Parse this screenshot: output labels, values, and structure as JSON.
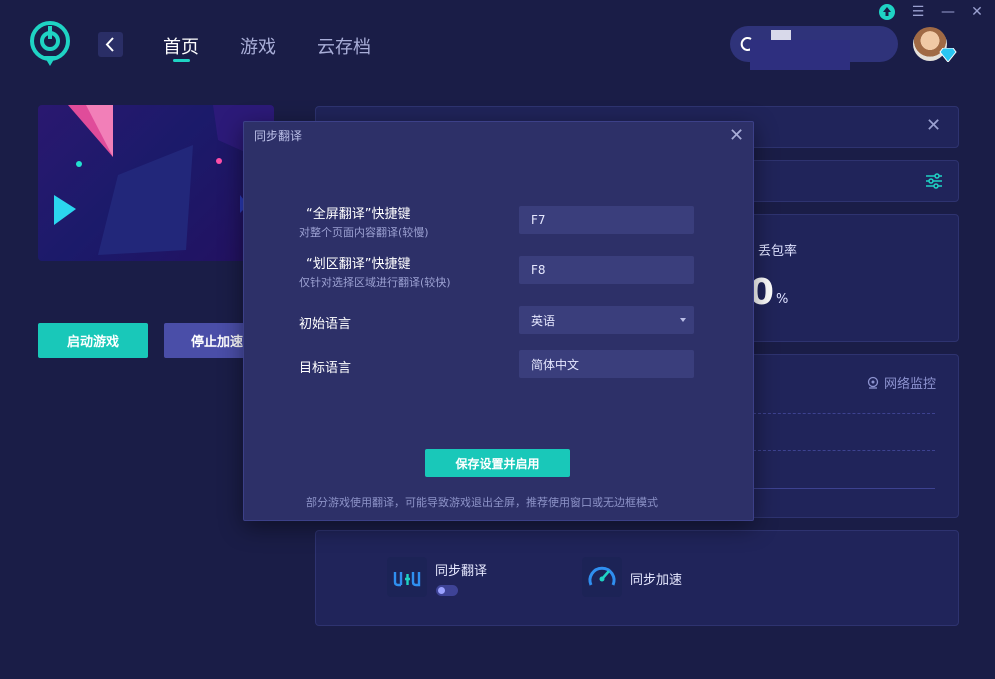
{
  "colors": {
    "accent": "#19c8b9",
    "background": "#1a1d47",
    "panel": "#20245a",
    "modal": "#2d3068"
  },
  "window_controls": {
    "update_icon": "upload-arrow-icon",
    "menu_glyph": "☰",
    "minimize_glyph": "—",
    "close_glyph": "✕"
  },
  "header": {
    "nav": [
      {
        "label": "首页",
        "active": true
      },
      {
        "label": "游戏",
        "active": false
      },
      {
        "label": "云存档",
        "active": false
      }
    ],
    "back_glyph": "‹"
  },
  "left": {
    "start_button": "启动游戏",
    "stop_button": "停止加速"
  },
  "stats": {
    "packet_loss_label": "丢包率",
    "packet_loss_value": "0",
    "packet_loss_unit": "%"
  },
  "monitor": {
    "label": "网络监控"
  },
  "features": [
    {
      "label": "同步翻译",
      "icon": "translate-icon",
      "toggle_on": false
    },
    {
      "label": "同步加速",
      "icon": "speedometer-icon"
    }
  ],
  "modal": {
    "title": "同步翻译",
    "close_glyph": "✕",
    "fields": [
      {
        "label": "“全屏翻译”快捷键",
        "sub": "对整个页面内容翻译(较慢)",
        "value": "F7"
      },
      {
        "label": "“划区翻译”快捷键",
        "sub": "仅针对选择区域进行翻译(较快)",
        "value": "F8"
      },
      {
        "label": "初始语言",
        "value": "英语"
      },
      {
        "label": "目标语言",
        "value": "简体中文"
      }
    ],
    "save_button": "保存设置并启用",
    "note": "部分游戏使用翻译，可能导致游戏退出全屏，推荐使用窗口或无边框模式"
  }
}
